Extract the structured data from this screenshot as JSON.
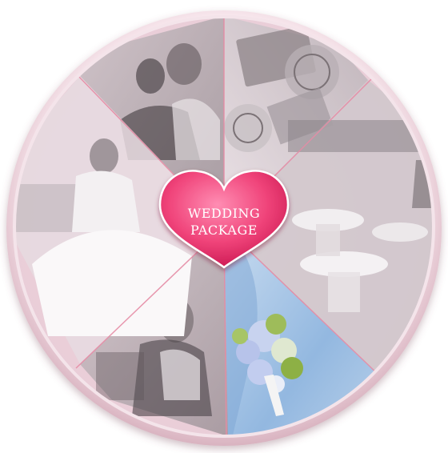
{
  "center": {
    "title_line1": "WEDDING",
    "title_line2": "PACKAGE"
  },
  "segments": [
    {
      "id": "couple-portrait",
      "icon": "couple-photo"
    },
    {
      "id": "invitation-cards",
      "icon": "invitation-photo"
    },
    {
      "id": "banquet-venue",
      "icon": "venue-photo"
    },
    {
      "id": "bridal-bouquet",
      "icon": "bouquet-photo",
      "highlighted": true
    },
    {
      "id": "bride-profile",
      "icon": "bride-photo"
    },
    {
      "id": "bride-gown",
      "icon": "gown-photo"
    }
  ],
  "colors": {
    "background": "#ffffff",
    "segment_tint": "#f3dde4",
    "divider": "#e58ca5",
    "rim": "#f0d2db",
    "heart_light": "#ff7aa5",
    "heart_dark": "#d81d5c",
    "bouquet_blue": "#a8c6e6",
    "text": "#ffffff"
  }
}
